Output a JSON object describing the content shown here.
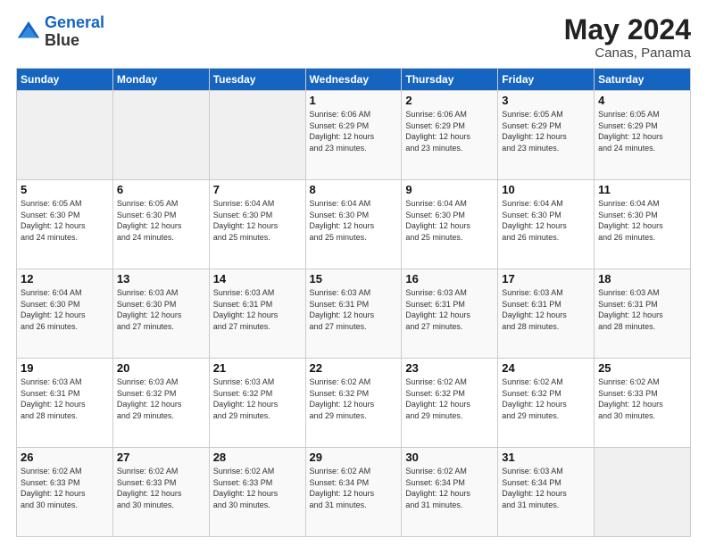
{
  "header": {
    "logo_line1": "General",
    "logo_line2": "Blue",
    "month_year": "May 2024",
    "location": "Canas, Panama"
  },
  "weekdays": [
    "Sunday",
    "Monday",
    "Tuesday",
    "Wednesday",
    "Thursday",
    "Friday",
    "Saturday"
  ],
  "weeks": [
    [
      {
        "day": "",
        "info": ""
      },
      {
        "day": "",
        "info": ""
      },
      {
        "day": "",
        "info": ""
      },
      {
        "day": "1",
        "info": "Sunrise: 6:06 AM\nSunset: 6:29 PM\nDaylight: 12 hours\nand 23 minutes."
      },
      {
        "day": "2",
        "info": "Sunrise: 6:06 AM\nSunset: 6:29 PM\nDaylight: 12 hours\nand 23 minutes."
      },
      {
        "day": "3",
        "info": "Sunrise: 6:05 AM\nSunset: 6:29 PM\nDaylight: 12 hours\nand 23 minutes."
      },
      {
        "day": "4",
        "info": "Sunrise: 6:05 AM\nSunset: 6:29 PM\nDaylight: 12 hours\nand 24 minutes."
      }
    ],
    [
      {
        "day": "5",
        "info": "Sunrise: 6:05 AM\nSunset: 6:30 PM\nDaylight: 12 hours\nand 24 minutes."
      },
      {
        "day": "6",
        "info": "Sunrise: 6:05 AM\nSunset: 6:30 PM\nDaylight: 12 hours\nand 24 minutes."
      },
      {
        "day": "7",
        "info": "Sunrise: 6:04 AM\nSunset: 6:30 PM\nDaylight: 12 hours\nand 25 minutes."
      },
      {
        "day": "8",
        "info": "Sunrise: 6:04 AM\nSunset: 6:30 PM\nDaylight: 12 hours\nand 25 minutes."
      },
      {
        "day": "9",
        "info": "Sunrise: 6:04 AM\nSunset: 6:30 PM\nDaylight: 12 hours\nand 25 minutes."
      },
      {
        "day": "10",
        "info": "Sunrise: 6:04 AM\nSunset: 6:30 PM\nDaylight: 12 hours\nand 26 minutes."
      },
      {
        "day": "11",
        "info": "Sunrise: 6:04 AM\nSunset: 6:30 PM\nDaylight: 12 hours\nand 26 minutes."
      }
    ],
    [
      {
        "day": "12",
        "info": "Sunrise: 6:04 AM\nSunset: 6:30 PM\nDaylight: 12 hours\nand 26 minutes."
      },
      {
        "day": "13",
        "info": "Sunrise: 6:03 AM\nSunset: 6:30 PM\nDaylight: 12 hours\nand 27 minutes."
      },
      {
        "day": "14",
        "info": "Sunrise: 6:03 AM\nSunset: 6:31 PM\nDaylight: 12 hours\nand 27 minutes."
      },
      {
        "day": "15",
        "info": "Sunrise: 6:03 AM\nSunset: 6:31 PM\nDaylight: 12 hours\nand 27 minutes."
      },
      {
        "day": "16",
        "info": "Sunrise: 6:03 AM\nSunset: 6:31 PM\nDaylight: 12 hours\nand 27 minutes."
      },
      {
        "day": "17",
        "info": "Sunrise: 6:03 AM\nSunset: 6:31 PM\nDaylight: 12 hours\nand 28 minutes."
      },
      {
        "day": "18",
        "info": "Sunrise: 6:03 AM\nSunset: 6:31 PM\nDaylight: 12 hours\nand 28 minutes."
      }
    ],
    [
      {
        "day": "19",
        "info": "Sunrise: 6:03 AM\nSunset: 6:31 PM\nDaylight: 12 hours\nand 28 minutes."
      },
      {
        "day": "20",
        "info": "Sunrise: 6:03 AM\nSunset: 6:32 PM\nDaylight: 12 hours\nand 29 minutes."
      },
      {
        "day": "21",
        "info": "Sunrise: 6:03 AM\nSunset: 6:32 PM\nDaylight: 12 hours\nand 29 minutes."
      },
      {
        "day": "22",
        "info": "Sunrise: 6:02 AM\nSunset: 6:32 PM\nDaylight: 12 hours\nand 29 minutes."
      },
      {
        "day": "23",
        "info": "Sunrise: 6:02 AM\nSunset: 6:32 PM\nDaylight: 12 hours\nand 29 minutes."
      },
      {
        "day": "24",
        "info": "Sunrise: 6:02 AM\nSunset: 6:32 PM\nDaylight: 12 hours\nand 29 minutes."
      },
      {
        "day": "25",
        "info": "Sunrise: 6:02 AM\nSunset: 6:33 PM\nDaylight: 12 hours\nand 30 minutes."
      }
    ],
    [
      {
        "day": "26",
        "info": "Sunrise: 6:02 AM\nSunset: 6:33 PM\nDaylight: 12 hours\nand 30 minutes."
      },
      {
        "day": "27",
        "info": "Sunrise: 6:02 AM\nSunset: 6:33 PM\nDaylight: 12 hours\nand 30 minutes."
      },
      {
        "day": "28",
        "info": "Sunrise: 6:02 AM\nSunset: 6:33 PM\nDaylight: 12 hours\nand 30 minutes."
      },
      {
        "day": "29",
        "info": "Sunrise: 6:02 AM\nSunset: 6:34 PM\nDaylight: 12 hours\nand 31 minutes."
      },
      {
        "day": "30",
        "info": "Sunrise: 6:02 AM\nSunset: 6:34 PM\nDaylight: 12 hours\nand 31 minutes."
      },
      {
        "day": "31",
        "info": "Sunrise: 6:03 AM\nSunset: 6:34 PM\nDaylight: 12 hours\nand 31 minutes."
      },
      {
        "day": "",
        "info": ""
      }
    ]
  ]
}
